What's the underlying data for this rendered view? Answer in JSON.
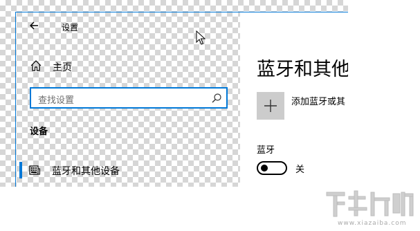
{
  "window": {
    "title": "设置"
  },
  "sidebar": {
    "home_label": "主页",
    "search": {
      "placeholder": "查找设置"
    },
    "category": "设备",
    "items": [
      {
        "label": "蓝牙和其他设备",
        "selected": true,
        "icon": "devices-icon"
      }
    ]
  },
  "content": {
    "page_title": "蓝牙和其他",
    "add_device_label": "添加蓝牙或其",
    "bluetooth": {
      "label": "蓝牙",
      "state": "关",
      "on": false
    }
  },
  "watermark": {
    "domain": "www.xiazaiba.com"
  },
  "colors": {
    "accent": "#0078d7",
    "tile": "#cccccc",
    "checker": "#d6d6d6"
  }
}
